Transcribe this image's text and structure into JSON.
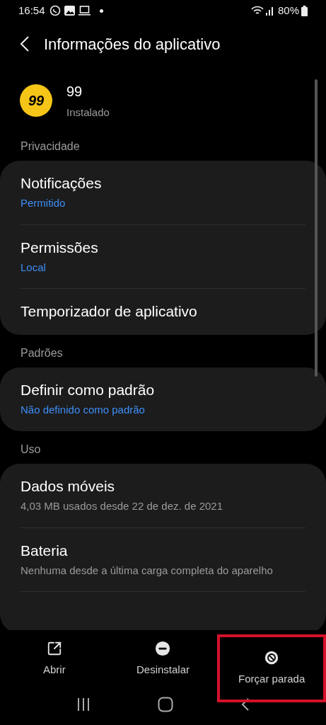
{
  "status_bar": {
    "time": "16:54",
    "battery": "80%"
  },
  "header": {
    "title": "Informações do aplicativo"
  },
  "app": {
    "icon_text": "99",
    "name": "99",
    "status": "Instalado"
  },
  "sections": [
    {
      "title": "Privacidade",
      "items": [
        {
          "title": "Notificações",
          "subtitle": "Permitido",
          "kind": "status"
        },
        {
          "title": "Permissões",
          "subtitle": "Local",
          "kind": "status"
        },
        {
          "title": "Temporizador de aplicativo",
          "kind": "plain"
        }
      ]
    },
    {
      "title": "Padrões",
      "items": [
        {
          "title": "Definir como padrão",
          "subtitle": "Não definido como padrão",
          "kind": "status"
        }
      ]
    },
    {
      "title": "Uso",
      "items": [
        {
          "title": "Dados móveis",
          "subtitle": "4,03 MB usados desde 22 de dez. de 2021",
          "kind": "info"
        },
        {
          "title": "Bateria",
          "subtitle": "Nenhuma desde a última carga completa do aparelho",
          "kind": "info"
        }
      ]
    }
  ],
  "actions": [
    {
      "label": "Abrir",
      "kind": "open",
      "highlighted": false
    },
    {
      "label": "Desinstalar",
      "kind": "uninstall",
      "highlighted": false
    },
    {
      "label": "Forçar parada",
      "kind": "stop",
      "highlighted": true
    }
  ]
}
